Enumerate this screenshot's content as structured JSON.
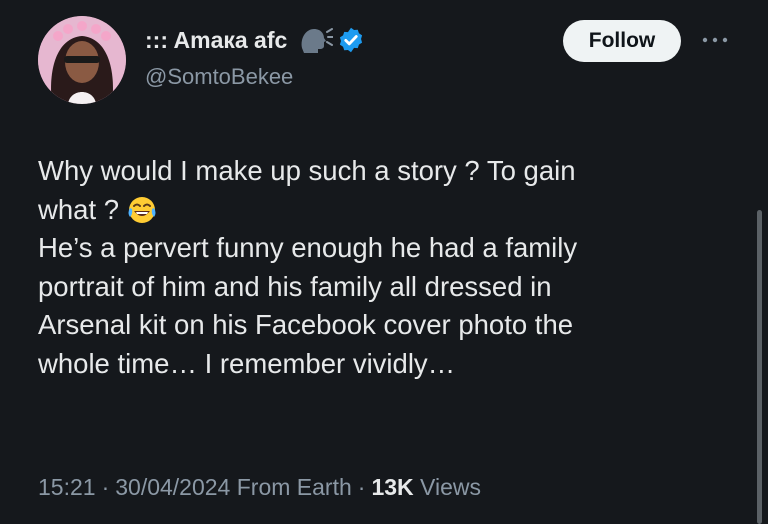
{
  "author": {
    "display_name": "::: Amaкa afc",
    "handle": "@SomtoBekee",
    "avatar_icon": "profile-photo",
    "badge_icons": [
      "speaking-head-icon",
      "verified-badge-icon"
    ],
    "verified_color": "#1d9bf0"
  },
  "follow_button": {
    "label": "Follow"
  },
  "more_menu": {
    "icon": "ellipsis-icon"
  },
  "tweet": {
    "lines": [
      "Why would I make up such a story ? To gain",
      "what ?",
      "He’s a pervert funny enough he had a family",
      "portrait of him and his family all dressed in",
      "Arsenal kit on his Facebook cover photo the",
      "whole time… I remember vividly…"
    ],
    "emoji_icon": "face-with-tears-of-joy-icon"
  },
  "meta": {
    "time": "15:21",
    "separator": "·",
    "date": "30/04/2024",
    "source": "From Earth",
    "views_count": "13K",
    "views_label": "Views"
  }
}
